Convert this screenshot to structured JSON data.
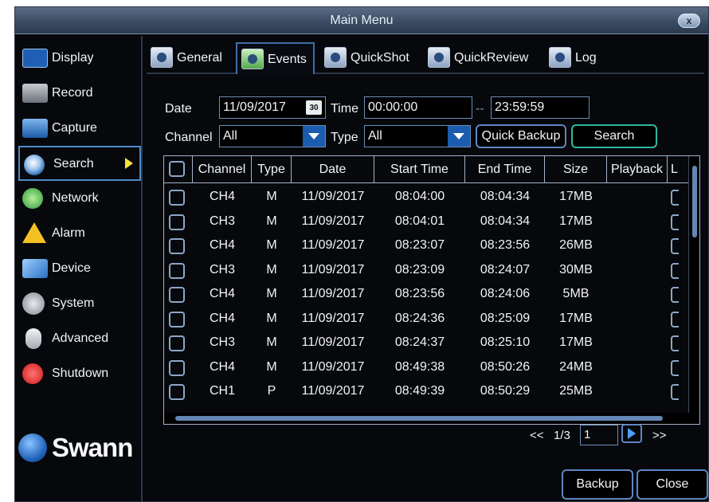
{
  "window": {
    "title": "Main Menu",
    "close_label": "x"
  },
  "colors": {
    "accent": "#4f8ac8",
    "active_tab": "#3f6fa5",
    "primary_button_border": "#2db89b",
    "arrow": "#f6e33a"
  },
  "sidebar": {
    "items": [
      {
        "label": "Display",
        "icon": "display-icon",
        "active": false
      },
      {
        "label": "Record",
        "icon": "record-icon",
        "active": false
      },
      {
        "label": "Capture",
        "icon": "camera-icon",
        "active": false
      },
      {
        "label": "Search",
        "icon": "search-icon",
        "active": true
      },
      {
        "label": "Network",
        "icon": "network-icon",
        "active": false
      },
      {
        "label": "Alarm",
        "icon": "alarm-warning-icon",
        "active": false
      },
      {
        "label": "Device",
        "icon": "device-tools-icon",
        "active": false
      },
      {
        "label": "System",
        "icon": "gear-icon",
        "active": false
      },
      {
        "label": "Advanced",
        "icon": "mouse-icon",
        "active": false
      },
      {
        "label": "Shutdown",
        "icon": "power-icon",
        "active": false
      }
    ],
    "logo_text": "Swann"
  },
  "tabs": [
    {
      "label": "General",
      "active": false
    },
    {
      "label": "Events",
      "active": true
    },
    {
      "label": "QuickShot",
      "active": false
    },
    {
      "label": "QuickReview",
      "active": false
    },
    {
      "label": "Log",
      "active": false
    }
  ],
  "filters": {
    "date_label": "Date",
    "date_value": "11/09/2017",
    "calendar_day": "30",
    "time_label": "Time",
    "time_start": "00:00:00",
    "time_separator": "--",
    "time_end": "23:59:59",
    "channel_label": "Channel",
    "channel_value": "All",
    "type_label": "Type",
    "type_value": "All",
    "quick_backup_label": "Quick Backup",
    "search_label": "Search"
  },
  "table": {
    "columns": [
      "Channel",
      "Type",
      "Date",
      "Start Time",
      "End Time",
      "Size",
      "Playback",
      "L"
    ],
    "rows": [
      [
        "CH4",
        "M",
        "11/09/2017",
        "08:04:00",
        "08:04:34",
        "17MB"
      ],
      [
        "CH3",
        "M",
        "11/09/2017",
        "08:04:01",
        "08:04:34",
        "17MB"
      ],
      [
        "CH4",
        "M",
        "11/09/2017",
        "08:23:07",
        "08:23:56",
        "26MB"
      ],
      [
        "CH3",
        "M",
        "11/09/2017",
        "08:23:09",
        "08:24:07",
        "30MB"
      ],
      [
        "CH4",
        "M",
        "11/09/2017",
        "08:23:56",
        "08:24:06",
        "5MB"
      ],
      [
        "CH4",
        "M",
        "11/09/2017",
        "08:24:36",
        "08:25:09",
        "17MB"
      ],
      [
        "CH3",
        "M",
        "11/09/2017",
        "08:24:37",
        "08:25:10",
        "17MB"
      ],
      [
        "CH4",
        "M",
        "11/09/2017",
        "08:49:38",
        "08:50:26",
        "24MB"
      ],
      [
        "CH1",
        "P",
        "11/09/2017",
        "08:49:39",
        "08:50:29",
        "25MB"
      ]
    ]
  },
  "pager": {
    "prev": "<<",
    "page_info": "1/3",
    "page_input": "1",
    "next": ">>"
  },
  "footer": {
    "backup_label": "Backup",
    "close_label": "Close"
  }
}
